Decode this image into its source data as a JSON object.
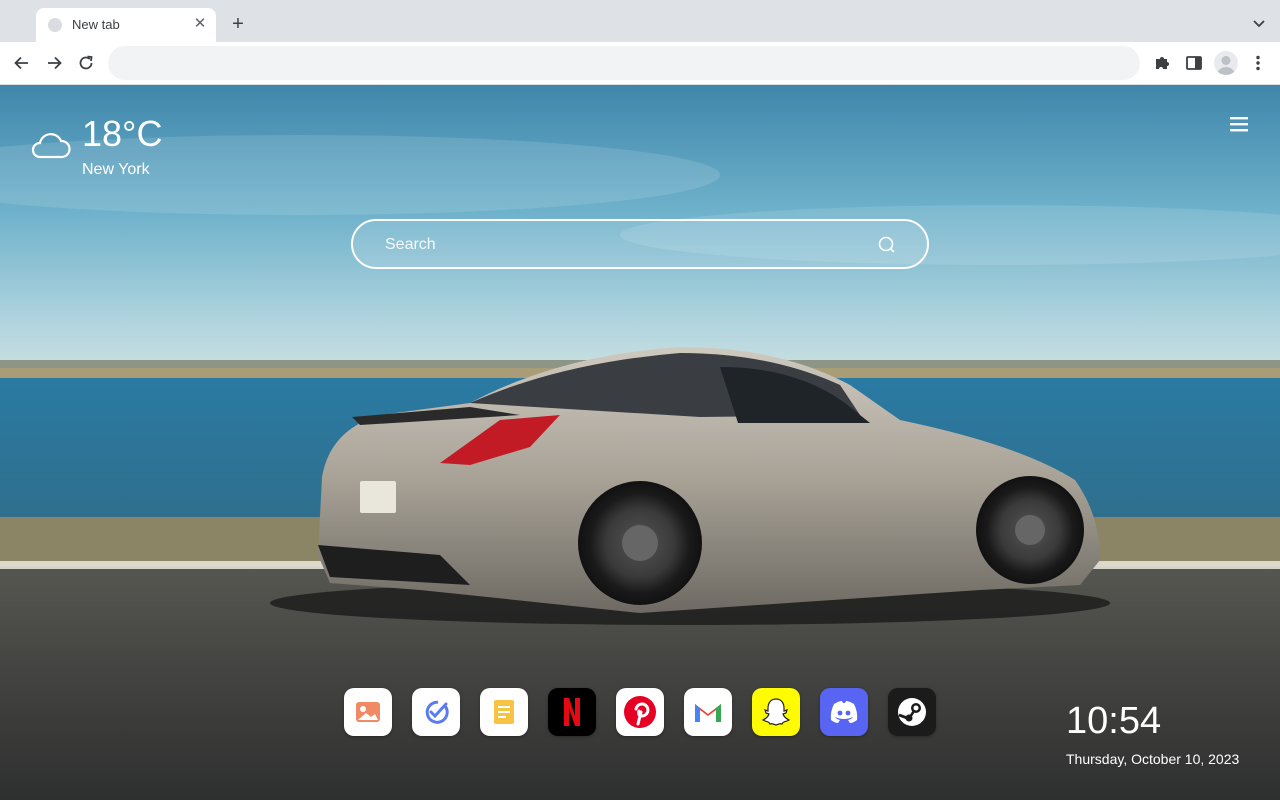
{
  "browser": {
    "tab_title": "New tab",
    "address_value": "",
    "colors": {
      "tabstrip": "#dee1e6",
      "toolbar": "#ffffff",
      "omnibox": "#f1f3f4"
    }
  },
  "weather": {
    "temperature": "18°C",
    "city": "New York",
    "icon": "cloud-icon"
  },
  "search": {
    "placeholder": "Search"
  },
  "apps": [
    {
      "name": "gallery",
      "icon": "gallery-icon"
    },
    {
      "name": "todo",
      "icon": "todo-check-icon"
    },
    {
      "name": "notes",
      "icon": "notes-icon"
    },
    {
      "name": "netflix",
      "icon": "netflix-icon",
      "color": "#e50914"
    },
    {
      "name": "pinterest",
      "icon": "pinterest-icon",
      "color": "#e60023"
    },
    {
      "name": "gmail",
      "icon": "gmail-icon",
      "color": "#ea4335"
    },
    {
      "name": "snapchat",
      "icon": "snapchat-icon",
      "color": "#fffc00"
    },
    {
      "name": "discord",
      "icon": "discord-icon",
      "color": "#5865f2"
    },
    {
      "name": "steam",
      "icon": "steam-icon",
      "color": "#1b1b1b"
    }
  ],
  "clock": {
    "time": "10:54",
    "date": "Thursday, October 10, 2023"
  }
}
